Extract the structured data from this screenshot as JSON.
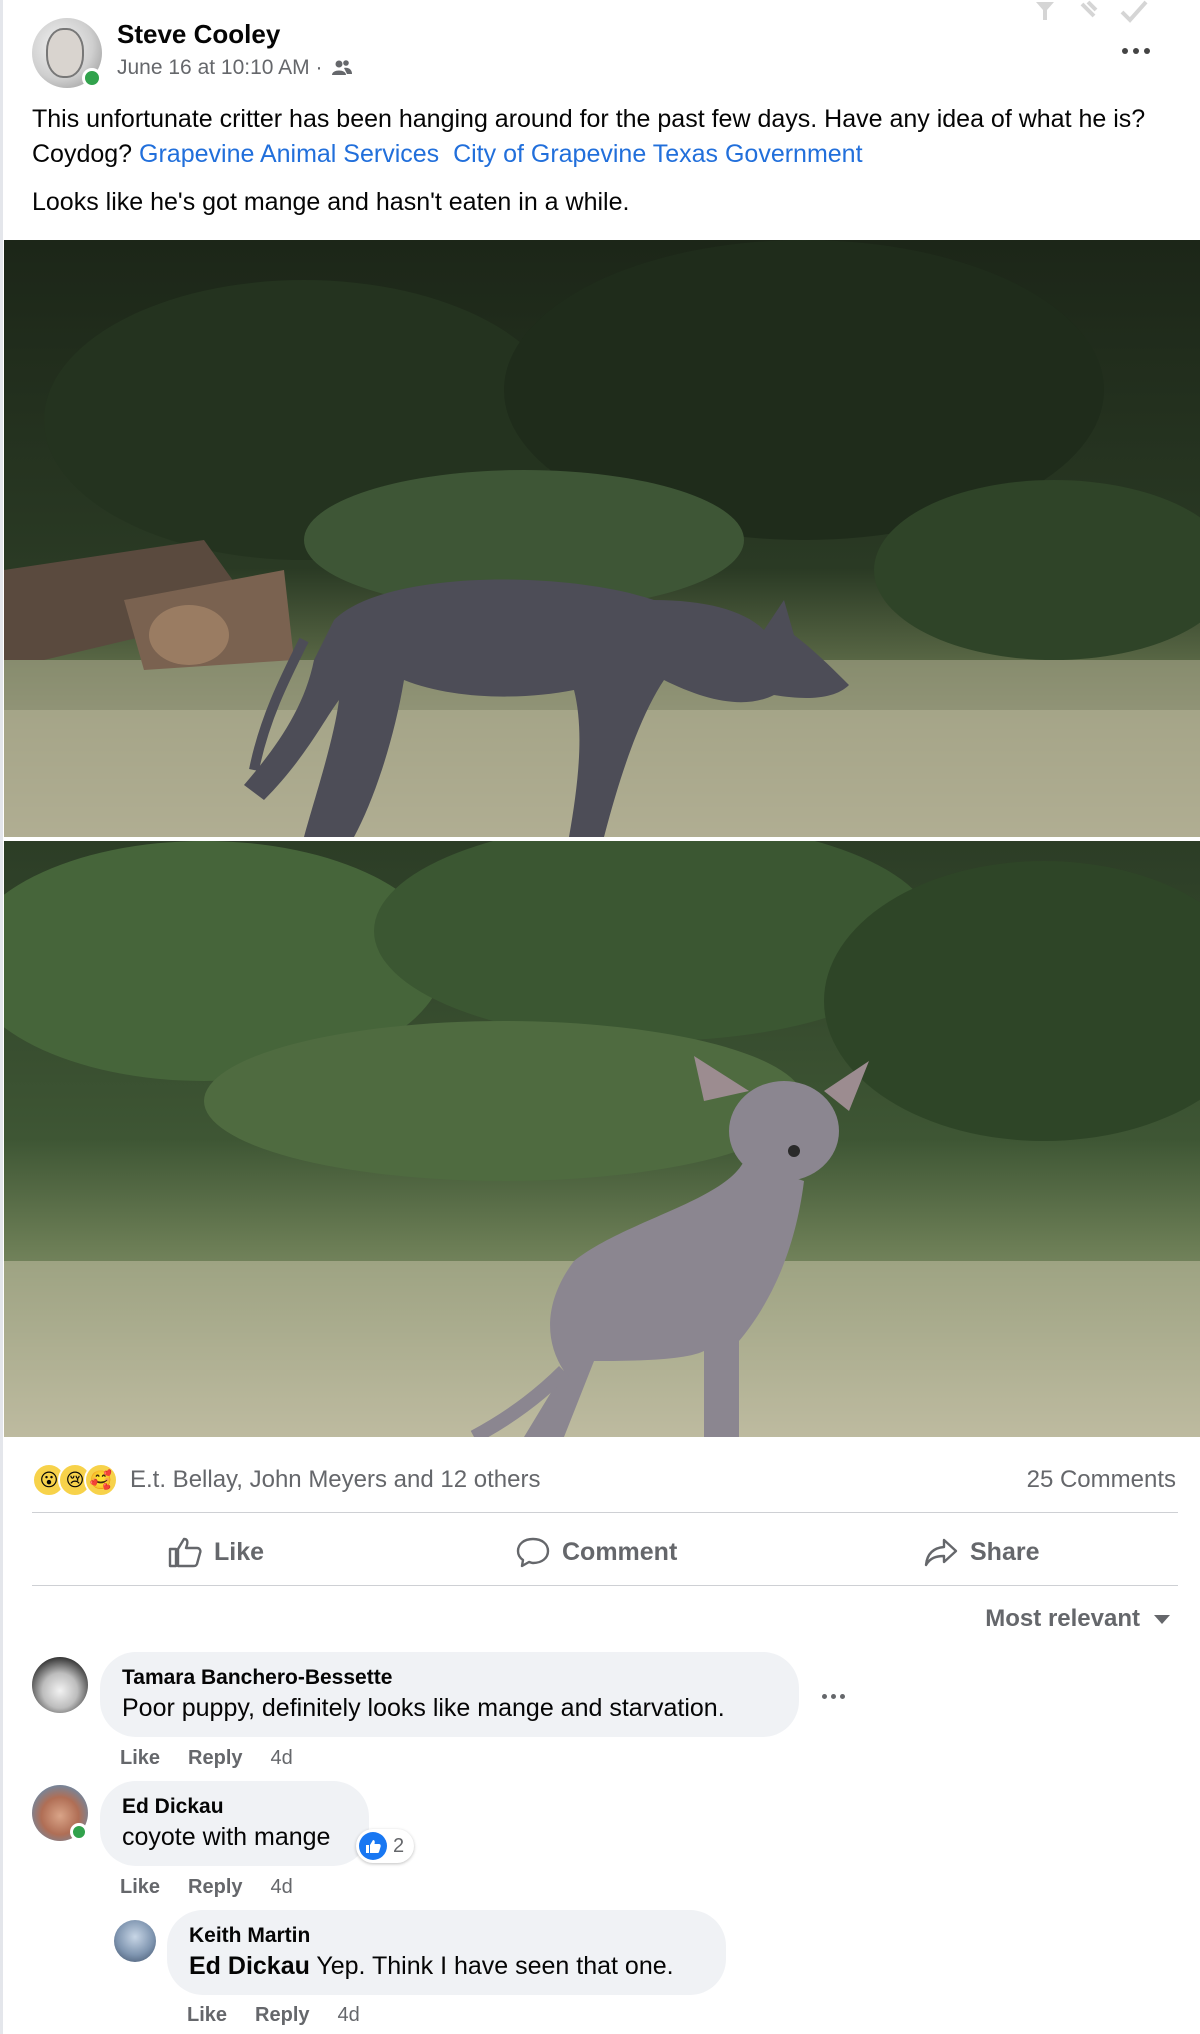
{
  "post": {
    "author": "Steve Cooley",
    "date": "June 16 at 10:10 AM",
    "separator": "·",
    "text_line1_prefix": "This  unfortunate critter has been hanging around for the past few days.  Have any idea of what he is?  Coydog? ",
    "mention1": "Grapevine Animal Services",
    "mention2": "City of Grapevine Texas Government",
    "text_line2": "Looks like he's got mange and hasn't eaten in a while."
  },
  "reactions": {
    "emojis": [
      "😮",
      "😢",
      "🥰"
    ],
    "summary": "E.t. Bellay, John Meyers and 12 others",
    "comments_count": "25 Comments"
  },
  "actions": {
    "like": "Like",
    "comment": "Comment",
    "share": "Share"
  },
  "sort": {
    "label": "Most relevant"
  },
  "comments": [
    {
      "name": "Tamara Banchero-Bessette",
      "text": "Poor puppy, definitely looks like mange and starvation.",
      "like": "Like",
      "reply": "Reply",
      "time": "4d"
    },
    {
      "name": "Ed Dickau",
      "text": "coyote with mange",
      "like_count": "2",
      "like": "Like",
      "reply": "Reply",
      "time": "4d"
    },
    {
      "name": "Keith Martin",
      "mention": "Ed Dickau",
      "text": " Yep. Think I have seen that one.",
      "like": "Like",
      "reply": "Reply",
      "time": "4d"
    }
  ],
  "colors": {
    "link": "#216fdb",
    "secondary_text": "#65676b",
    "bubble": "#f0f2f5",
    "online": "#31a24c",
    "like_blue": "#1877f2"
  },
  "icons": [
    "audience-friends-icon",
    "more-options-icon",
    "thumbs-up-icon",
    "comment-icon",
    "share-icon",
    "caret-down-icon"
  ]
}
